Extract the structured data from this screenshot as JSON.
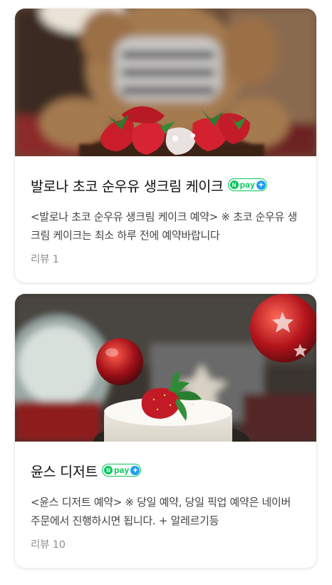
{
  "listings": [
    {
      "title": "발로나 초코 순우유 생크림 케이크",
      "description": "<발로나 초코 순우유 생크림 케이크 예약> ※ 초코 순우유 생크림 케이크는 최소 하루 전에 예약바랍니다",
      "review": "리뷰 1",
      "image": "cake-photo"
    },
    {
      "title": "윤스 디저트",
      "description": "<윤스 디저트 예약> ※ 당일 예약, 당일 픽업 예약은 네이버 주문에서 진행하시면 됩니다. + 알레르기등",
      "review": "리뷰 10",
      "image": "dessert-photo"
    }
  ],
  "badge": {
    "n": "N",
    "pay": "pay",
    "plus": "+"
  },
  "colors": {
    "npay_green": "#03c75a",
    "npay_blue": "#1e9cf0",
    "title": "#111111",
    "description": "#444444",
    "review": "#8e8e8e"
  }
}
